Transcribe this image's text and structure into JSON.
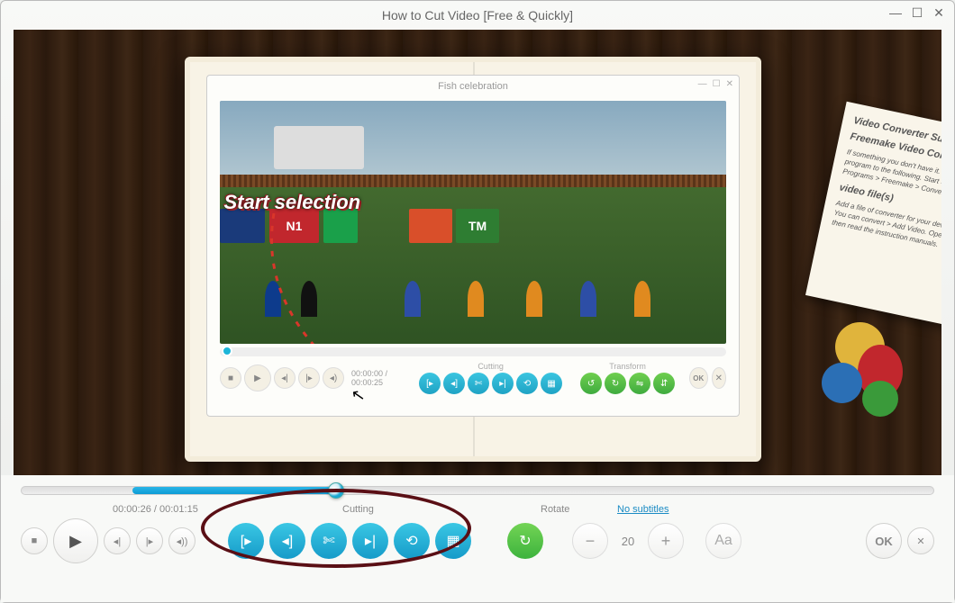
{
  "window": {
    "title": "How to Cut Video [Free & Quickly]"
  },
  "inner": {
    "title": "Fish celebration",
    "callout": "1. Start selection",
    "time": "00:00:00 / 00:00:25",
    "cutting_label": "Cutting",
    "transform_label": "Transform",
    "ok": "OK",
    "ads": {
      "n1": "N1",
      "tm": "TM"
    }
  },
  "paper": {
    "h1": "Video Converter Support",
    "h2": "Freemake Video Converter",
    "p1": "If something you don't have it. Turn the program to the following. Start > All Programs > Freemake > Conversion",
    "h3": "video file(s)",
    "p2": "Add a file of converter for your device. You can convert > Add Video. Open, then read the instruction manuals."
  },
  "controls": {
    "time": "00:00:26 / 00:01:15",
    "cutting_label": "Cutting",
    "rotate_label": "Rotate",
    "subtitles_label": "No subtitles",
    "zoom": "20",
    "ok": "OK",
    "aa": "Aa"
  },
  "icons": {
    "stop": "■",
    "play": "▶",
    "prev": "◂|",
    "next": "|▸",
    "vol": "◂))",
    "sel_start": "[▸",
    "sel_end": "◂]",
    "cut": "✄",
    "trim": "▸|",
    "clear": "⟲",
    "frame": "▦",
    "rotate": "↻",
    "minus": "−",
    "plus": "+",
    "close": "✕",
    "win_min": "—",
    "win_max": "☐",
    "win_close": "✕"
  }
}
